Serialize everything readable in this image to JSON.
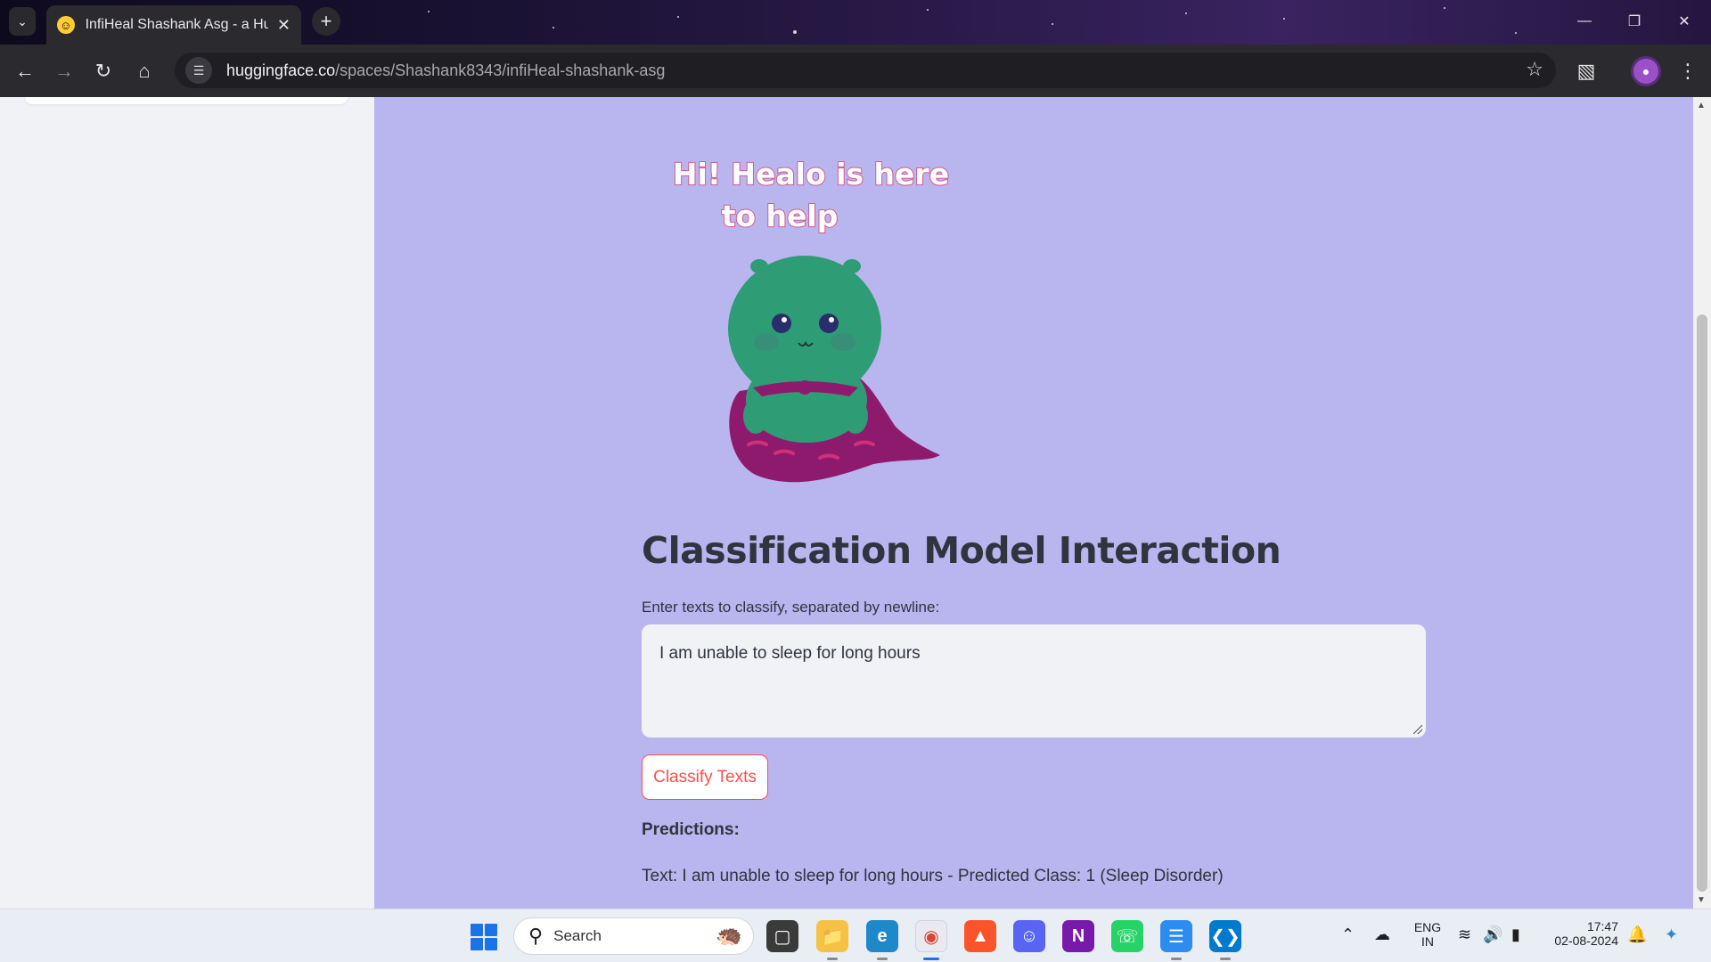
{
  "browser": {
    "tab_title": "InfiHeal Shashank Asg - a Hugg",
    "url_host": "huggingface.co",
    "url_path": "/spaces/Shashank8343/infiHeal-shashank-asg"
  },
  "app": {
    "mascot_caption_line1": "Hi! Healo is here",
    "mascot_caption_line2": "to help",
    "title": "Classification Model Interaction",
    "input_label": "Enter texts to classify, separated by newline:",
    "input_value": "I am unable to sleep for long hours",
    "classify_button_label": "Classify Texts",
    "predictions_heading": "Predictions:",
    "prediction_line": "Text: I am unable to sleep for long hours - Predicted Class: 1 (Sleep Disorder)"
  },
  "taskbar": {
    "search_label": "Search",
    "language_line1": "ENG",
    "language_line2": "IN",
    "time": "17:47",
    "date": "02-08-2024"
  },
  "colors": {
    "page_background": "#b9b5ef",
    "accent_red": "#ff4b4b",
    "mascot_green": "#2e9c74",
    "cape_purple": "#8e1a6e"
  }
}
